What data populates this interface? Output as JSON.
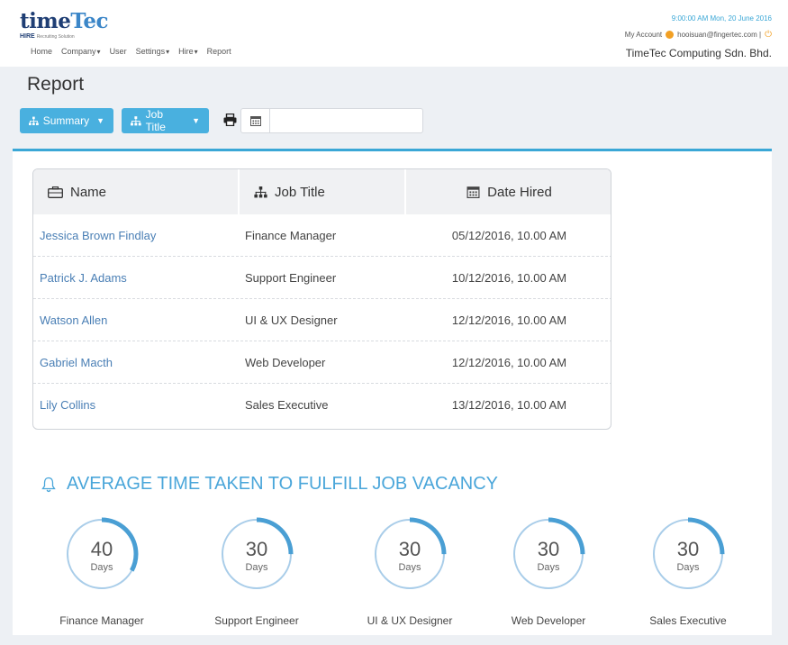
{
  "brand": {
    "logo_time": "time",
    "logo_tec": "Tec",
    "logo_hire": "HIRE",
    "logo_tag": "Recruiting Solution"
  },
  "nav": [
    {
      "label": "Home",
      "dropdown": false
    },
    {
      "label": "Company",
      "dropdown": true
    },
    {
      "label": "User",
      "dropdown": false
    },
    {
      "label": "Settings",
      "dropdown": true
    },
    {
      "label": "Hire",
      "dropdown": true
    },
    {
      "label": "Report",
      "dropdown": false
    }
  ],
  "header": {
    "datetime": "9:00:00 AM Mon, 20 June 2016",
    "account_label": "My Account",
    "account_email": "hooisuan@fingertec.com |",
    "company": "TimeTec Computing Sdn. Bhd."
  },
  "page": {
    "title": "Report"
  },
  "toolbar": {
    "summary_label": "Summary",
    "jobtitle_label": "Job Title",
    "date_value": "",
    "date_placeholder": ""
  },
  "table": {
    "headers": [
      "Name",
      "Job Title",
      "Date Hired"
    ],
    "rows": [
      {
        "name": "Jessica Brown Findlay",
        "job": "Finance Manager",
        "date": "05/12/2016, 10.00 AM"
      },
      {
        "name": "Patrick J. Adams",
        "job": "Support Engineer",
        "date": "10/12/2016, 10.00 AM"
      },
      {
        "name": "Watson Allen",
        "job": "UI & UX Designer",
        "date": "12/12/2016, 10.00 AM"
      },
      {
        "name": "Gabriel Macth",
        "job": "Web Developer",
        "date": "12/12/2016, 10.00 AM"
      },
      {
        "name": "Lily Collins",
        "job": "Sales Executive",
        "date": "13/12/2016, 10.00 AM"
      }
    ]
  },
  "section": {
    "title": "AVERAGE TIME TAKEN TO FULFILL JOB VACANCY"
  },
  "metrics": [
    {
      "value": "40",
      "unit": "Days",
      "label": "Finance Manager",
      "fraction": 0.33
    },
    {
      "value": "30",
      "unit": "Days",
      "label": "Support Engineer",
      "fraction": 0.25
    },
    {
      "value": "30",
      "unit": "Days",
      "label": "UI & UX Designer",
      "fraction": 0.25
    },
    {
      "value": "30",
      "unit": "Days",
      "label": "Web Developer",
      "fraction": 0.25
    },
    {
      "value": "30",
      "unit": "Days",
      "label": "Sales Executive",
      "fraction": 0.25
    }
  ],
  "colors": {
    "accent": "#3aa7d6",
    "button": "#49b0df",
    "ring": "#4a9fd4",
    "ring_track": "#a9cde9",
    "link": "#4a7fb5",
    "brand_dark": "#1f3e74",
    "warning": "#f2a024"
  },
  "icons": {
    "power": "⏻",
    "print": "🖶",
    "calendar": "▦"
  }
}
